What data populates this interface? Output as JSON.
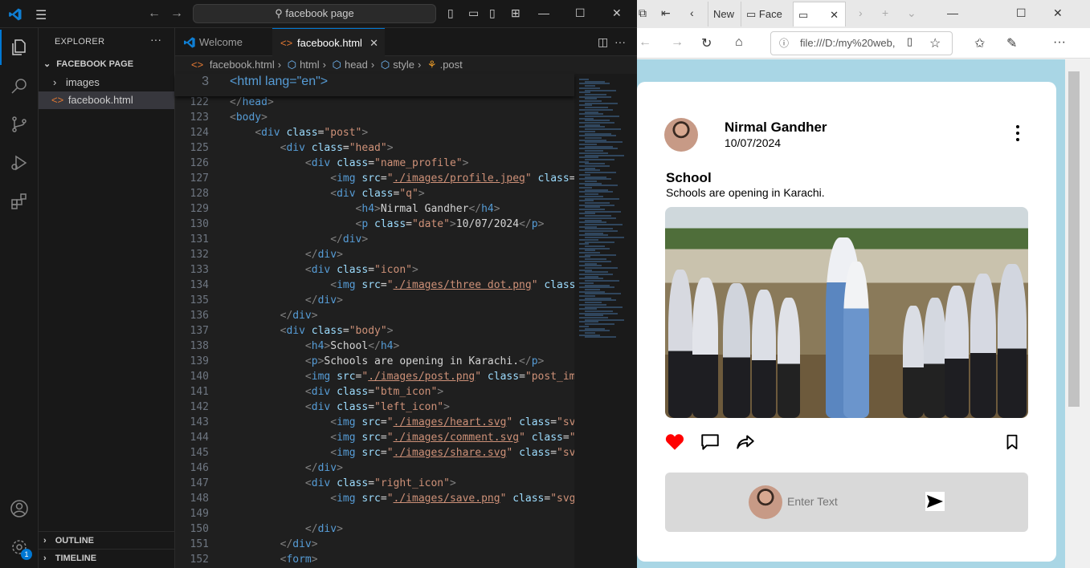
{
  "vscode": {
    "command_center": "facebook page",
    "explorer": {
      "title": "EXPLORER",
      "folder": "FACEBOOK PAGE",
      "items": [
        "images",
        "facebook.html"
      ],
      "outline": "OUTLINE",
      "timeline": "TIMELINE"
    },
    "tabs": [
      "Welcome",
      "facebook.html"
    ],
    "breadcrumb": [
      "facebook.html",
      "html",
      "head",
      "style",
      ".post"
    ],
    "settings_badge": "1",
    "sticky_line": {
      "num": "3",
      "text": "<html lang=\"en\">"
    },
    "lines": [
      {
        "num": "122",
        "indent": 0,
        "segments": [
          [
            "tag",
            "</"
          ],
          [
            "tn",
            "head"
          ],
          [
            "tag",
            ">"
          ]
        ]
      },
      {
        "num": "123",
        "indent": 0,
        "segments": [
          [
            "tag",
            "<"
          ],
          [
            "tn",
            "body"
          ],
          [
            "tag",
            ">"
          ]
        ]
      },
      {
        "num": "124",
        "indent": 1,
        "segments": [
          [
            "tag",
            "<"
          ],
          [
            "tn",
            "div "
          ],
          [
            "at",
            "class"
          ],
          [
            "tx",
            "="
          ],
          [
            "st",
            "\"post\""
          ],
          [
            "tag",
            ">"
          ]
        ]
      },
      {
        "num": "125",
        "indent": 2,
        "segments": [
          [
            "tag",
            "<"
          ],
          [
            "tn",
            "div "
          ],
          [
            "at",
            "class"
          ],
          [
            "tx",
            "="
          ],
          [
            "st",
            "\"head\""
          ],
          [
            "tag",
            ">"
          ]
        ]
      },
      {
        "num": "126",
        "indent": 3,
        "segments": [
          [
            "tag",
            "<"
          ],
          [
            "tn",
            "div "
          ],
          [
            "at",
            "class"
          ],
          [
            "tx",
            "="
          ],
          [
            "st",
            "\"name_profile\""
          ],
          [
            "tag",
            ">"
          ]
        ]
      },
      {
        "num": "127",
        "indent": 4,
        "segments": [
          [
            "tag",
            "<"
          ],
          [
            "tn",
            "img "
          ],
          [
            "at",
            "src"
          ],
          [
            "tx",
            "="
          ],
          [
            "st",
            "\""
          ],
          [
            "stu",
            "./images/profile.jpeg"
          ],
          [
            "st",
            "\" "
          ],
          [
            "at",
            "class"
          ],
          [
            "tx",
            "="
          ],
          [
            "st",
            "\""
          ]
        ]
      },
      {
        "num": "128",
        "indent": 4,
        "segments": [
          [
            "tag",
            "<"
          ],
          [
            "tn",
            "div "
          ],
          [
            "at",
            "class"
          ],
          [
            "tx",
            "="
          ],
          [
            "st",
            "\"q\""
          ],
          [
            "tag",
            ">"
          ]
        ]
      },
      {
        "num": "129",
        "indent": 5,
        "segments": [
          [
            "tag",
            "<"
          ],
          [
            "tn",
            "h4"
          ],
          [
            "tag",
            ">"
          ],
          [
            "tx",
            "Nirmal Gandher"
          ],
          [
            "tag",
            "</"
          ],
          [
            "tn",
            "h4"
          ],
          [
            "tag",
            ">"
          ]
        ]
      },
      {
        "num": "130",
        "indent": 5,
        "segments": [
          [
            "tag",
            "<"
          ],
          [
            "tn",
            "p "
          ],
          [
            "at",
            "class"
          ],
          [
            "tx",
            "="
          ],
          [
            "st",
            "\"date\""
          ],
          [
            "tag",
            ">"
          ],
          [
            "tx",
            "10/07/2024"
          ],
          [
            "tag",
            "</"
          ],
          [
            "tn",
            "p"
          ],
          [
            "tag",
            ">"
          ]
        ]
      },
      {
        "num": "131",
        "indent": 4,
        "segments": [
          [
            "tag",
            "</"
          ],
          [
            "tn",
            "div"
          ],
          [
            "tag",
            ">"
          ]
        ]
      },
      {
        "num": "132",
        "indent": 3,
        "segments": [
          [
            "tag",
            "</"
          ],
          [
            "tn",
            "div"
          ],
          [
            "tag",
            ">"
          ]
        ]
      },
      {
        "num": "133",
        "indent": 3,
        "segments": [
          [
            "tag",
            "<"
          ],
          [
            "tn",
            "div "
          ],
          [
            "at",
            "class"
          ],
          [
            "tx",
            "="
          ],
          [
            "st",
            "\"icon\""
          ],
          [
            "tag",
            ">"
          ]
        ]
      },
      {
        "num": "134",
        "indent": 4,
        "segments": [
          [
            "tag",
            "<"
          ],
          [
            "tn",
            "img "
          ],
          [
            "at",
            "src"
          ],
          [
            "tx",
            "="
          ],
          [
            "st",
            "\""
          ],
          [
            "stu",
            "./images/three dot.png"
          ],
          [
            "st",
            "\" "
          ],
          [
            "at",
            "class"
          ],
          [
            "tx",
            "="
          ]
        ]
      },
      {
        "num": "135",
        "indent": 3,
        "segments": [
          [
            "tag",
            "</"
          ],
          [
            "tn",
            "div"
          ],
          [
            "tag",
            ">"
          ]
        ]
      },
      {
        "num": "136",
        "indent": 2,
        "segments": [
          [
            "tag",
            "</"
          ],
          [
            "tn",
            "div"
          ],
          [
            "tag",
            ">"
          ]
        ]
      },
      {
        "num": "137",
        "indent": 2,
        "segments": [
          [
            "tag",
            "<"
          ],
          [
            "tn",
            "div "
          ],
          [
            "at",
            "class"
          ],
          [
            "tx",
            "="
          ],
          [
            "st",
            "\"body\""
          ],
          [
            "tag",
            ">"
          ]
        ]
      },
      {
        "num": "138",
        "indent": 3,
        "segments": [
          [
            "tag",
            "<"
          ],
          [
            "tn",
            "h4"
          ],
          [
            "tag",
            ">"
          ],
          [
            "tx",
            "School"
          ],
          [
            "tag",
            "</"
          ],
          [
            "tn",
            "h4"
          ],
          [
            "tag",
            ">"
          ]
        ]
      },
      {
        "num": "139",
        "indent": 3,
        "segments": [
          [
            "tag",
            "<"
          ],
          [
            "tn",
            "p"
          ],
          [
            "tag",
            ">"
          ],
          [
            "tx",
            "Schools are opening in Karachi."
          ],
          [
            "tag",
            "</"
          ],
          [
            "tn",
            "p"
          ],
          [
            "tag",
            ">"
          ]
        ]
      },
      {
        "num": "140",
        "indent": 3,
        "segments": [
          [
            "tag",
            "<"
          ],
          [
            "tn",
            "img "
          ],
          [
            "at",
            "src"
          ],
          [
            "tx",
            "="
          ],
          [
            "st",
            "\""
          ],
          [
            "stu",
            "./images/post.png"
          ],
          [
            "st",
            "\" "
          ],
          [
            "at",
            "class"
          ],
          [
            "tx",
            "="
          ],
          [
            "st",
            "\"post_ima"
          ]
        ]
      },
      {
        "num": "141",
        "indent": 3,
        "segments": [
          [
            "tag",
            "<"
          ],
          [
            "tn",
            "div "
          ],
          [
            "at",
            "class"
          ],
          [
            "tx",
            "="
          ],
          [
            "st",
            "\"btm_icon\""
          ],
          [
            "tag",
            ">"
          ]
        ]
      },
      {
        "num": "142",
        "indent": 3,
        "segments": [
          [
            "tag",
            "<"
          ],
          [
            "tn",
            "div "
          ],
          [
            "at",
            "class"
          ],
          [
            "tx",
            "="
          ],
          [
            "st",
            "\"left_icon\""
          ],
          [
            "tag",
            ">"
          ]
        ]
      },
      {
        "num": "143",
        "indent": 4,
        "segments": [
          [
            "tag",
            "<"
          ],
          [
            "tn",
            "img "
          ],
          [
            "at",
            "src"
          ],
          [
            "tx",
            "="
          ],
          [
            "st",
            "\""
          ],
          [
            "stu",
            "./images/heart.svg"
          ],
          [
            "st",
            "\" "
          ],
          [
            "at",
            "class"
          ],
          [
            "tx",
            "="
          ],
          [
            "st",
            "\"svg"
          ]
        ]
      },
      {
        "num": "144",
        "indent": 4,
        "segments": [
          [
            "tag",
            "<"
          ],
          [
            "tn",
            "img "
          ],
          [
            "at",
            "src"
          ],
          [
            "tx",
            "="
          ],
          [
            "st",
            "\""
          ],
          [
            "stu",
            "./images/comment.svg"
          ],
          [
            "st",
            "\" "
          ],
          [
            "at",
            "class"
          ],
          [
            "tx",
            "="
          ],
          [
            "st",
            "\"s"
          ]
        ]
      },
      {
        "num": "145",
        "indent": 4,
        "segments": [
          [
            "tag",
            "<"
          ],
          [
            "tn",
            "img "
          ],
          [
            "at",
            "src"
          ],
          [
            "tx",
            "="
          ],
          [
            "st",
            "\""
          ],
          [
            "stu",
            "./images/share.svg"
          ],
          [
            "st",
            "\" "
          ],
          [
            "at",
            "class"
          ],
          [
            "tx",
            "="
          ],
          [
            "st",
            "\"svg"
          ]
        ]
      },
      {
        "num": "146",
        "indent": 3,
        "segments": [
          [
            "tag",
            "</"
          ],
          [
            "tn",
            "div"
          ],
          [
            "tag",
            ">"
          ]
        ]
      },
      {
        "num": "147",
        "indent": 3,
        "segments": [
          [
            "tag",
            "<"
          ],
          [
            "tn",
            "div "
          ],
          [
            "at",
            "class"
          ],
          [
            "tx",
            "="
          ],
          [
            "st",
            "\"right_icon\""
          ],
          [
            "tag",
            ">"
          ]
        ]
      },
      {
        "num": "148",
        "indent": 4,
        "segments": [
          [
            "tag",
            "<"
          ],
          [
            "tn",
            "img "
          ],
          [
            "at",
            "src"
          ],
          [
            "tx",
            "="
          ],
          [
            "st",
            "\""
          ],
          [
            "stu",
            "./images/save.png"
          ],
          [
            "st",
            "\" "
          ],
          [
            "at",
            "class"
          ],
          [
            "tx",
            "="
          ],
          [
            "st",
            "\"svg"
          ]
        ]
      },
      {
        "num": "149",
        "indent": 4,
        "segments": []
      },
      {
        "num": "150",
        "indent": 3,
        "segments": [
          [
            "tag",
            "</"
          ],
          [
            "tn",
            "div"
          ],
          [
            "tag",
            ">"
          ]
        ]
      },
      {
        "num": "151",
        "indent": 2,
        "segments": [
          [
            "tag",
            "</"
          ],
          [
            "tn",
            "div"
          ],
          [
            "tag",
            ">"
          ]
        ]
      },
      {
        "num": "152",
        "indent": 2,
        "segments": [
          [
            "tag",
            "<"
          ],
          [
            "tn",
            "form"
          ],
          [
            "tag",
            ">"
          ]
        ]
      }
    ]
  },
  "browser": {
    "tabs": [
      "New",
      "Face"
    ],
    "url": "file:///D:/my%20web,",
    "post": {
      "name": "Nirmal Gandher",
      "date": "10/07/2024",
      "title": "School",
      "text": "Schools are opening in Karachi.",
      "input_placeholder": "Enter Text"
    },
    "colors": {
      "page_bg": "#a9d6e5",
      "heart": "#ff0000",
      "form_bg": "#d9d9d9"
    }
  }
}
